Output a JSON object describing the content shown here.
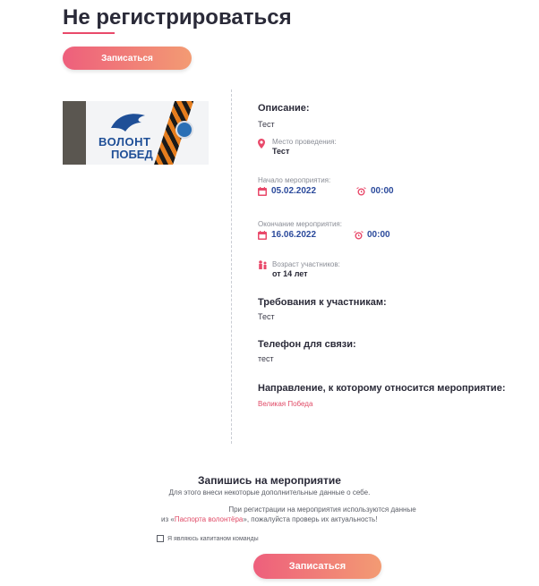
{
  "page": {
    "title": "Не регистрироваться",
    "top_button_label": "Записаться"
  },
  "event_image": {
    "text_line1": "ВОЛОНТ",
    "text_line2": "ПОБЕД"
  },
  "details": {
    "description_heading": "Описание:",
    "description_value": "Тест",
    "place_label": "Место проведения:",
    "place_value": "Тест",
    "start_label": "Начало мероприятия:",
    "start_date": "05.02.2022",
    "start_time": "00:00",
    "end_label": "Окончание мероприятия:",
    "end_date": "16.06.2022",
    "end_time": "00:00",
    "age_label": "Возраст участников:",
    "age_value": "от 14 лет",
    "requirements_heading": "Требования к участникам:",
    "requirements_value": "Тест",
    "phone_heading": "Телефон для связи:",
    "phone_value": "тест",
    "direction_heading": "Направление, к которому относится мероприятие:",
    "direction_value": "Великая Победа"
  },
  "register": {
    "heading": "Запишись на мероприятие",
    "subtitle": "Для этого внеси некоторые дополнительные данные о себе.",
    "note_line1": "При регистрации на мероприятия используются данные",
    "note_line2_prefix": "из «",
    "passport_link": "Паспорта волонтёра",
    "note_line2_suffix": "», пожалуйста проверь их актуальность!",
    "checkbox_label": "Я являюсь капитаном команды",
    "button_label": "Записаться"
  },
  "colors": {
    "accent": "#e9496a",
    "button_gradient_start": "#ee5f7c",
    "button_gradient_end": "#f39b73",
    "date_text": "#2b4a9c",
    "icon_pink": "#e9496a"
  },
  "icons": {
    "place": "location-pin-icon",
    "start_date": "calendar-icon",
    "start_time": "alarm-clock-icon",
    "end_date": "calendar-icon",
    "end_time": "alarm-clock-icon",
    "age": "people-icon"
  }
}
